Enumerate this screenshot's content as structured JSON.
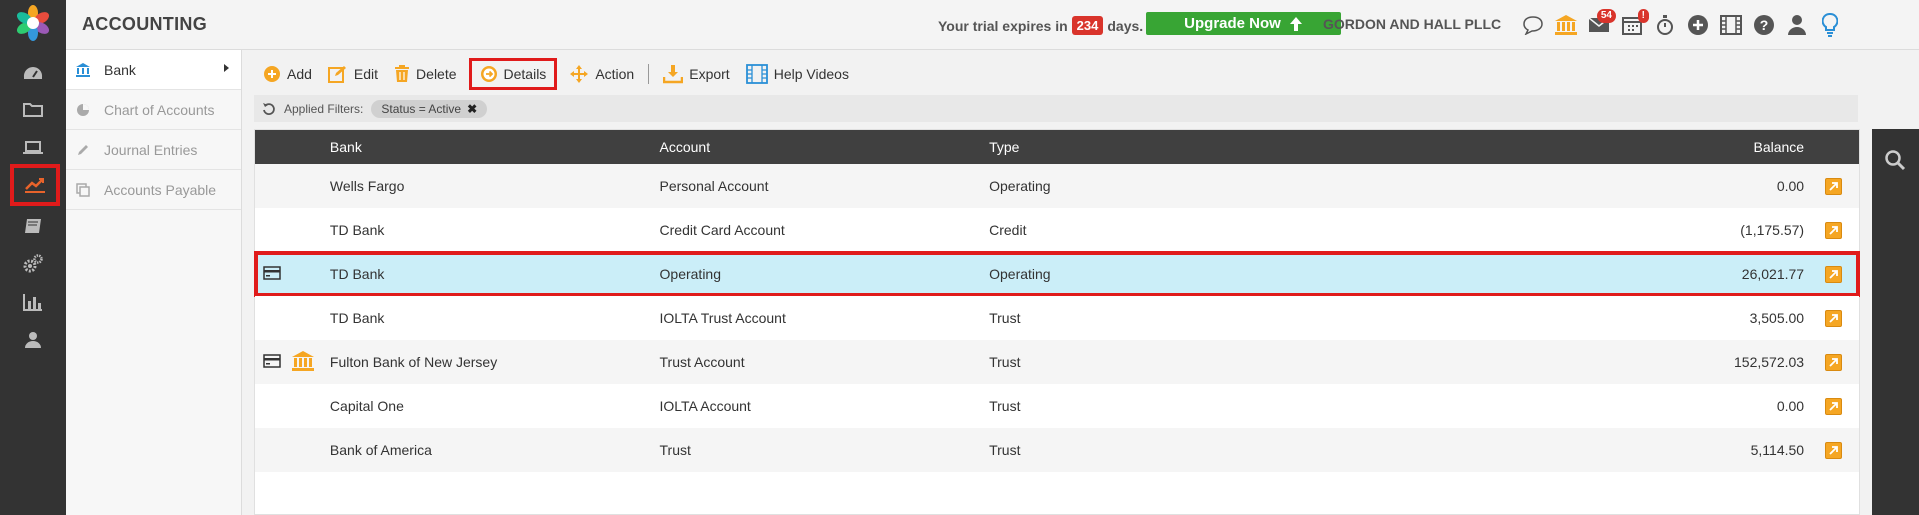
{
  "header": {
    "title": "ACCOUNTING",
    "trial_prefix": "Your trial expires in",
    "trial_days": "234",
    "trial_suffix": "days.",
    "upgrade_label": "Upgrade Now",
    "firm_name": "GORDON AND HALL PLLC",
    "mail_count": "54",
    "calendar_alert": "!"
  },
  "rail": {
    "items": [
      "dashboard-icon",
      "folder-icon",
      "laptop-icon",
      "accounting-chart-icon",
      "book-icon",
      "settings-icon",
      "reports-icon",
      "user-icon"
    ],
    "active": "accounting-chart-icon"
  },
  "subnav": {
    "items": [
      {
        "label": "Bank",
        "icon": "bank-icon",
        "active": true
      },
      {
        "label": "Chart of Accounts",
        "icon": "pie-chart-icon",
        "active": false
      },
      {
        "label": "Journal Entries",
        "icon": "pencil-icon",
        "active": false
      },
      {
        "label": "Accounts Payable",
        "icon": "copy-icon",
        "active": false
      }
    ]
  },
  "toolbar": {
    "add": "Add",
    "edit": "Edit",
    "delete": "Delete",
    "details": "Details",
    "action": "Action",
    "export": "Export",
    "help_videos": "Help Videos"
  },
  "filters": {
    "label": "Applied Filters:",
    "chip": "Status = Active"
  },
  "table": {
    "columns": {
      "bank": "Bank",
      "account": "Account",
      "type": "Type",
      "balance": "Balance"
    },
    "rows": [
      {
        "bank": "Wells Fargo",
        "account": "Personal Account",
        "type": "Operating",
        "balance": "0.00",
        "card": false,
        "trust": false,
        "selected": false
      },
      {
        "bank": "TD Bank",
        "account": "Credit Card Account",
        "type": "Credit",
        "balance": "(1,175.57)",
        "card": false,
        "trust": false,
        "selected": false
      },
      {
        "bank": "TD Bank",
        "account": "Operating",
        "type": "Operating",
        "balance": "26,021.77",
        "card": true,
        "trust": false,
        "selected": true
      },
      {
        "bank": "TD Bank",
        "account": "IOLTA Trust Account",
        "type": "Trust",
        "balance": "3,505.00",
        "card": false,
        "trust": false,
        "selected": false
      },
      {
        "bank": "Fulton Bank of New Jersey",
        "account": "Trust Account",
        "type": "Trust",
        "balance": "152,572.03",
        "card": true,
        "trust": true,
        "selected": false
      },
      {
        "bank": "Capital One",
        "account": "IOLTA Account",
        "type": "Trust",
        "balance": "0.00",
        "card": false,
        "trust": false,
        "selected": false
      },
      {
        "bank": "Bank of America",
        "account": "Trust",
        "type": "Trust",
        "balance": "5,114.50",
        "card": false,
        "trust": false,
        "selected": false
      }
    ]
  },
  "colors": {
    "accent_orange": "#f5a623",
    "highlight_red": "#e01b1b",
    "upgrade_green": "#38a534",
    "selected_row": "#cbeef8",
    "dark_rail": "#333333"
  }
}
